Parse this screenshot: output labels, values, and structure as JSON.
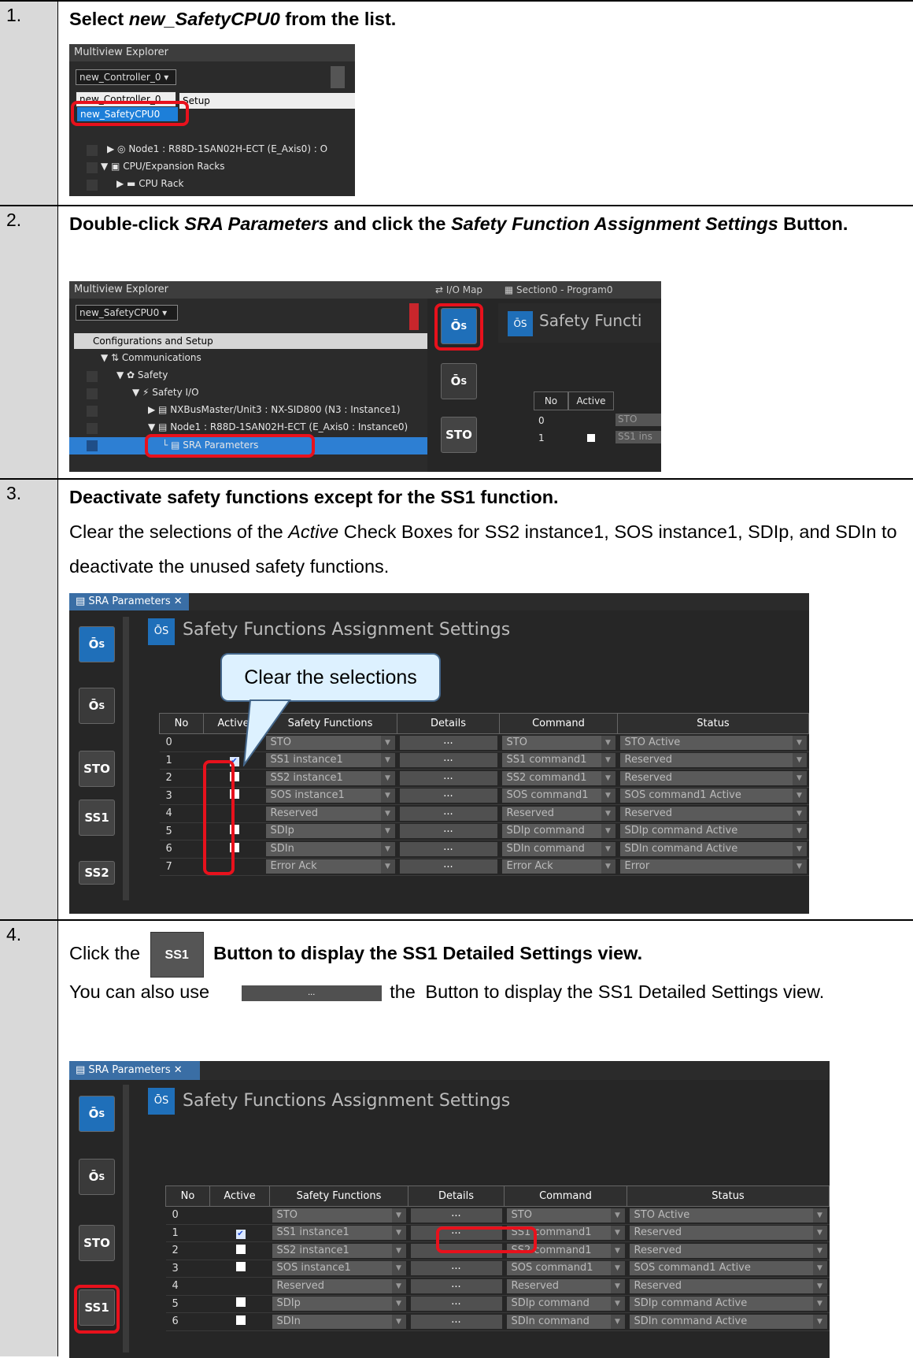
{
  "steps": [
    {
      "num": "1.",
      "text_a": "Select ",
      "text_b": "new_SafetyCPU0",
      "text_c": " from the list."
    },
    {
      "num": "2.",
      "text_a": "Double-click ",
      "text_b": "SRA Parameters",
      "text_c": " and click the ",
      "text_d": "Safety Function Assignment Settings",
      "text_e": " Button."
    },
    {
      "num": "3.",
      "title": "Deactivate safety functions except for the SS1 function.",
      "body_a": "Clear the selections of the ",
      "body_b": "Active",
      "body_c": " Check Boxes for SS2 instance1, SOS instance1, SDIp, and SDIn to deactivate the unused safety functions."
    },
    {
      "num": "4.",
      "line1_a": "Click the ",
      "line1_b": " Button to display the SS1 Detailed Settings view.",
      "line2_a": "You can also use ",
      "line2_b": " the ",
      "line2_c": "Button to display the SS1 Detailed Settings view.",
      "btn_ss1": "SS1",
      "btn_dots": "..."
    }
  ],
  "shot1": {
    "panel_title": "Multiview Explorer",
    "dropdown_value": "new_Controller_0",
    "list_items": [
      "new_Controller_0",
      "new_SafetyCPU0"
    ],
    "setup_text": "Setup",
    "tree": [
      "Node1 : R88D-1SAN02H-ECT (E_Axis0) : O",
      "CPU/Expansion Racks",
      "CPU Rack"
    ]
  },
  "shot2": {
    "panel_title": "Multiview Explorer",
    "dropdown_value": "new_SafetyCPU0",
    "tree": [
      "Configurations and Setup",
      "Communications",
      "Safety",
      "Safety I/O",
      "NXBusMaster/Unit3 : NX-SID800 (N3 : Instance1)",
      "Node1 : R88D-1SAN02H-ECT (E_Axis0 : Instance0)",
      "SRA Parameters"
    ],
    "tabs": [
      "I/O Map",
      "Section0 - Program0"
    ],
    "header": "Safety Functi",
    "grid_headers": [
      "No",
      "Active"
    ],
    "grid_rows": [
      "0",
      "1"
    ],
    "grid_cells": [
      "STO",
      "SS1 ins"
    ],
    "btn_sto": "STO"
  },
  "shot3": {
    "tab": "SRA Parameters",
    "header": "Safety Functions Assignment Settings",
    "callout": "Clear the selections",
    "side_buttons": [
      "STO",
      "SS1",
      "SS2"
    ],
    "columns": [
      "No",
      "Active",
      "Safety Functions",
      "Details",
      "Command",
      "Status"
    ],
    "rows": [
      {
        "no": "0",
        "active": "",
        "fn": "STO",
        "cmd": "STO",
        "status": "STO Active"
      },
      {
        "no": "1",
        "active": "on",
        "fn": "SS1 instance1",
        "cmd": "SS1 command1",
        "status": "Reserved"
      },
      {
        "no": "2",
        "active": "off",
        "fn": "SS2 instance1",
        "cmd": "SS2 command1",
        "status": "Reserved"
      },
      {
        "no": "3",
        "active": "off",
        "fn": "SOS instance1",
        "cmd": "SOS command1",
        "status": "SOS command1 Active"
      },
      {
        "no": "4",
        "active": "",
        "fn": "Reserved",
        "cmd": "Reserved",
        "status": "Reserved"
      },
      {
        "no": "5",
        "active": "off",
        "fn": "SDIp",
        "cmd": "SDIp command",
        "status": "SDIp command Active"
      },
      {
        "no": "6",
        "active": "off",
        "fn": "SDIn",
        "cmd": "SDIn command",
        "status": "SDIn command Active"
      },
      {
        "no": "7",
        "active": "",
        "fn": "Error Ack",
        "cmd": "Error Ack",
        "status": "Error"
      }
    ],
    "details_label": "..."
  },
  "shot4": {
    "tab": "SRA Parameters",
    "header": "Safety Functions Assignment Settings",
    "side_buttons": [
      "STO",
      "SS1"
    ],
    "columns": [
      "No",
      "Active",
      "Safety Functions",
      "Details",
      "Command",
      "Status"
    ],
    "rows": [
      {
        "no": "0",
        "active": "",
        "fn": "STO",
        "cmd": "STO",
        "status": "STO Active"
      },
      {
        "no": "1",
        "active": "on",
        "fn": "SS1 instance1",
        "cmd": "SS1 command1",
        "status": "Reserved"
      },
      {
        "no": "2",
        "active": "off",
        "fn": "SS2 instance1",
        "cmd": "SS2 command1",
        "status": "Reserved"
      },
      {
        "no": "3",
        "active": "off",
        "fn": "SOS instance1",
        "cmd": "SOS command1",
        "status": "SOS command1 Active"
      },
      {
        "no": "4",
        "active": "",
        "fn": "Reserved",
        "cmd": "Reserved",
        "status": "Reserved"
      },
      {
        "no": "5",
        "active": "off",
        "fn": "SDIp",
        "cmd": "SDIp command",
        "status": "SDIp command Active"
      },
      {
        "no": "6",
        "active": "off",
        "fn": "SDIn",
        "cmd": "SDIn command",
        "status": "SDIn command Active"
      }
    ],
    "details_label": "..."
  }
}
